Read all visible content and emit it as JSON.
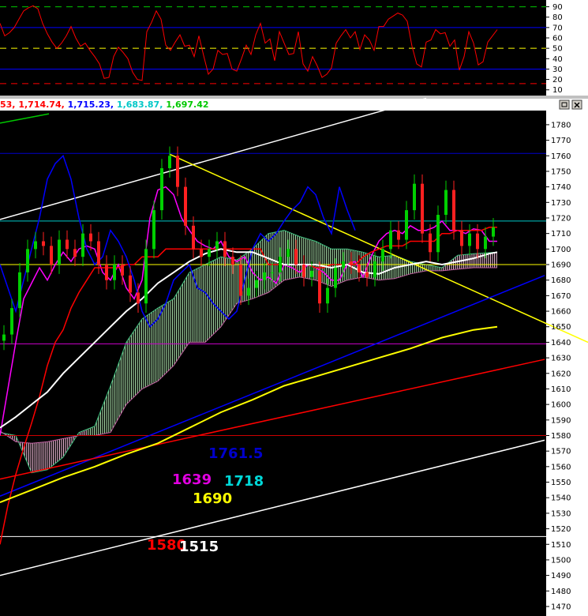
{
  "chart_data": [
    {
      "type": "line",
      "panel": "oscillator",
      "ylim": [
        6,
        95
      ],
      "y_ticks": [
        "90",
        "80",
        "70",
        "60",
        "50",
        "40",
        "30",
        "20",
        "10"
      ],
      "levels": [
        {
          "value": 90,
          "color": "#00c800",
          "style": "dashed"
        },
        {
          "value": 70,
          "color": "#0000ff",
          "style": "solid"
        },
        {
          "value": 50,
          "color": "#ffff00",
          "style": "dashed"
        },
        {
          "value": 30,
          "color": "#0000ff",
          "style": "solid"
        },
        {
          "value": 16,
          "color": "#ff0000",
          "style": "dashed"
        }
      ],
      "series": [
        {
          "color": "#ff0000",
          "values": [
            74,
            62,
            65,
            70,
            78,
            86,
            89,
            91,
            88,
            74,
            64,
            56,
            50,
            55,
            62,
            71,
            60,
            52,
            55,
            48,
            42,
            35,
            21,
            22,
            42,
            51,
            46,
            40,
            27,
            20,
            19,
            66,
            75,
            86,
            78,
            53,
            48,
            56,
            63,
            52,
            53,
            42,
            62,
            43,
            25,
            30,
            48,
            44,
            45,
            30,
            28,
            40,
            53,
            44,
            63,
            74,
            55,
            59,
            38,
            66,
            55,
            44,
            45,
            66,
            35,
            28,
            42,
            33,
            22,
            25,
            31,
            55,
            62,
            68,
            60,
            66,
            49,
            63,
            58,
            48,
            71,
            71,
            78,
            81,
            84,
            82,
            76,
            52,
            35,
            32,
            56,
            58,
            68,
            64,
            65,
            52,
            58,
            29,
            42,
            66,
            55,
            34,
            37,
            56,
            62,
            68
          ]
        }
      ]
    },
    {
      "type": "line",
      "panel": "price",
      "ylim": [
        1465,
        1790
      ],
      "y_ticks": [
        "1780",
        "1770",
        "1760",
        "1750",
        "1740",
        "1730",
        "1720",
        "1710",
        "1700",
        "1690",
        "1680",
        "1670",
        "1660",
        "1650",
        "1640",
        "1630",
        "1620",
        "1610",
        "1600",
        "1590",
        "1580",
        "1570",
        "1560",
        "1550",
        "1540",
        "1530",
        "1520",
        "1510",
        "1500",
        "1490",
        "1480",
        "1470"
      ],
      "header_values": [
        "53",
        "1,714.74",
        "1,715.23",
        "1,683.87",
        "1,697.42"
      ],
      "header_colors": [
        "#ff0000",
        "#ff0000",
        "#0000ff",
        "#00c8c8",
        "#00c800"
      ],
      "horizontal_lines": [
        {
          "value": 1761.5,
          "color": "#0000cc"
        },
        {
          "value": 1718,
          "color": "#00c8c8"
        },
        {
          "value": 1690,
          "color": "#ffff00"
        },
        {
          "value": 1639,
          "color": "#cc00cc"
        },
        {
          "value": 1580,
          "color": "#cc0000"
        },
        {
          "value": 1515,
          "color": "#ffffff"
        }
      ],
      "annotations": [
        {
          "text": "1761.5",
          "color": "#0000cc"
        },
        {
          "text": "1639",
          "color": "#e000e0"
        },
        {
          "text": "1718",
          "color": "#00d8d8"
        },
        {
          "text": "1690",
          "color": "#ffff00"
        },
        {
          "text": "1580",
          "color": "#ff0000"
        },
        {
          "text": "1515",
          "color": "#ffffff"
        }
      ],
      "trendlines": [
        {
          "color": "#ffffff",
          "from": [
            0,
            1719
          ],
          "to": [
            540,
            1797
          ]
        },
        {
          "color": "#ffff00",
          "from": [
            215,
            1761
          ],
          "to": [
            745,
            1640
          ]
        },
        {
          "color": "#0000ff",
          "from": [
            0,
            1541
          ],
          "to": [
            690,
            1683
          ]
        },
        {
          "color": "#ff0000",
          "from": [
            0,
            1552
          ],
          "to": [
            690,
            1629
          ]
        },
        {
          "color": "#ffffff",
          "from": [
            0,
            1490
          ],
          "to": [
            690,
            1577
          ]
        },
        {
          "color": "#00c800",
          "from": [
            0,
            1781
          ],
          "to": [
            62,
            1787
          ]
        }
      ],
      "series": [
        {
          "name": "close",
          "color": "#00c800",
          "x": [
            5,
            15,
            25,
            35,
            45,
            55,
            65,
            75,
            85,
            95,
            105,
            115,
            125,
            135,
            145,
            155,
            165,
            175,
            185,
            195,
            205,
            215,
            225,
            235,
            245,
            255,
            265,
            275,
            285,
            295,
            305,
            315,
            325,
            335,
            345,
            355,
            365,
            375,
            385,
            395,
            405,
            415,
            425,
            435,
            445,
            455,
            465,
            475,
            485,
            495,
            505,
            515,
            525,
            535,
            545,
            555,
            565,
            575,
            585,
            595,
            605,
            615,
            625
          ],
          "values": [
            1645,
            1662,
            1685,
            1700,
            1705,
            1702,
            1690,
            1706,
            1700,
            1695,
            1710,
            1705,
            1690,
            1680,
            1690,
            1683,
            1672,
            1665,
            1700,
            1725,
            1752,
            1760,
            1740,
            1715,
            1700,
            1695,
            1700,
            1705,
            1695,
            1690,
            1670,
            1675,
            1680,
            1685,
            1685,
            1695,
            1700,
            1690,
            1682,
            1686,
            1665,
            1675,
            1688,
            1692,
            1690,
            1685,
            1682,
            1692,
            1700,
            1712,
            1706,
            1725,
            1742,
            1710,
            1698,
            1722,
            1738,
            1712,
            1702,
            1710,
            1700,
            1708,
            1714
          ]
        },
        {
          "name": "tenkan",
          "color": "#ff00ff",
          "x": [
            0,
            10,
            20,
            30,
            40,
            50,
            60,
            70,
            80,
            90,
            100,
            110,
            120,
            130,
            140,
            150,
            160,
            170,
            180,
            190,
            200,
            210,
            220,
            230,
            240,
            250,
            260,
            270,
            280,
            290,
            300,
            310,
            320,
            330,
            340,
            350,
            360,
            370,
            380,
            390,
            400,
            410,
            420,
            430,
            440,
            450,
            460,
            470,
            480,
            490,
            500,
            510,
            520,
            530,
            540,
            550,
            560,
            570,
            580,
            590,
            600,
            610,
            620,
            630
          ],
          "values": [
            1580,
            1610,
            1640,
            1668,
            1678,
            1688,
            1680,
            1690,
            1698,
            1692,
            1700,
            1702,
            1700,
            1685,
            1680,
            1690,
            1675,
            1668,
            1680,
            1720,
            1738,
            1740,
            1735,
            1720,
            1712,
            1705,
            1702,
            1700,
            1705,
            1695,
            1692,
            1695,
            1685,
            1680,
            1682,
            1678,
            1690,
            1688,
            1685,
            1690,
            1688,
            1685,
            1680,
            1680,
            1690,
            1692,
            1682,
            1695,
            1705,
            1710,
            1712,
            1710,
            1715,
            1712,
            1712,
            1714,
            1718,
            1712,
            1712,
            1710,
            1713,
            1712,
            1705,
            1705
          ]
        },
        {
          "name": "kijun",
          "color": "#ff0000",
          "x": [
            0,
            10,
            20,
            30,
            40,
            50,
            60,
            70,
            80,
            90,
            100,
            110,
            120,
            130,
            140,
            150,
            160,
            170,
            180,
            190,
            200,
            210,
            220,
            230,
            240,
            250,
            260,
            270,
            280,
            290,
            300,
            310,
            320,
            330,
            340,
            350,
            360,
            370,
            380,
            390,
            400,
            410,
            420,
            430,
            440,
            450,
            460,
            470,
            480,
            490,
            500,
            510,
            520,
            530,
            540,
            550,
            560,
            570,
            580,
            590,
            600,
            610,
            620,
            630
          ],
          "values": [
            1510,
            1535,
            1555,
            1572,
            1588,
            1605,
            1625,
            1640,
            1648,
            1662,
            1672,
            1680,
            1688,
            1688,
            1688,
            1688,
            1690,
            1690,
            1695,
            1695,
            1695,
            1700,
            1700,
            1700,
            1700,
            1700,
            1700,
            1700,
            1700,
            1700,
            1700,
            1700,
            1700,
            1700,
            1690,
            1690,
            1690,
            1690,
            1690,
            1690,
            1688,
            1688,
            1690,
            1690,
            1690,
            1690,
            1695,
            1698,
            1700,
            1702,
            1702,
            1702,
            1705,
            1705,
            1705,
            1705,
            1710,
            1710,
            1712,
            1712,
            1712,
            1712,
            1714,
            1714
          ]
        },
        {
          "name": "chikou",
          "color": "#0000ff",
          "x": [
            0,
            10,
            20,
            30,
            40,
            50,
            60,
            70,
            80,
            90,
            100,
            110,
            120,
            130,
            140,
            150,
            160,
            170,
            180,
            190,
            200,
            210,
            220,
            230,
            240,
            250,
            260,
            270,
            280,
            290,
            300,
            310,
            320,
            330,
            340,
            350,
            360,
            370,
            380,
            390,
            400,
            410,
            420,
            430,
            440,
            450
          ],
          "values": [
            1690,
            1675,
            1660,
            1680,
            1700,
            1720,
            1745,
            1755,
            1760,
            1745,
            1720,
            1700,
            1690,
            1695,
            1712,
            1705,
            1695,
            1680,
            1660,
            1650,
            1655,
            1665,
            1680,
            1685,
            1690,
            1675,
            1672,
            1665,
            1660,
            1655,
            1660,
            1680,
            1700,
            1710,
            1705,
            1710,
            1718,
            1725,
            1730,
            1740,
            1735,
            1720,
            1710,
            1740,
            1725,
            1712
          ]
        },
        {
          "name": "ma_white",
          "color": "#ffffff",
          "x": [
            0,
            20,
            40,
            60,
            80,
            100,
            120,
            140,
            160,
            180,
            200,
            220,
            240,
            260,
            280,
            300,
            320,
            340,
            360,
            380,
            400,
            420,
            440,
            460,
            480,
            500,
            520,
            540,
            560,
            580,
            600,
            620,
            630
          ],
          "values": [
            1585,
            1592,
            1600,
            1608,
            1620,
            1630,
            1640,
            1650,
            1660,
            1668,
            1678,
            1685,
            1692,
            1697,
            1700,
            1698,
            1698,
            1694,
            1690,
            1690,
            1690,
            1688,
            1690,
            1685,
            1684,
            1688,
            1690,
            1692,
            1690,
            1692,
            1694,
            1697,
            1698
          ]
        },
        {
          "name": "ma_yellow",
          "color": "#ffff00",
          "x": [
            0,
            40,
            80,
            120,
            160,
            200,
            240,
            280,
            320,
            360,
            400,
            440,
            480,
            520,
            560,
            600,
            630
          ],
          "values": [
            1537,
            1545,
            1553,
            1560,
            1568,
            1575,
            1585,
            1595,
            1603,
            1612,
            1618,
            1624,
            1630,
            1636,
            1643,
            1648,
            1650
          ]
        }
      ]
    }
  ]
}
